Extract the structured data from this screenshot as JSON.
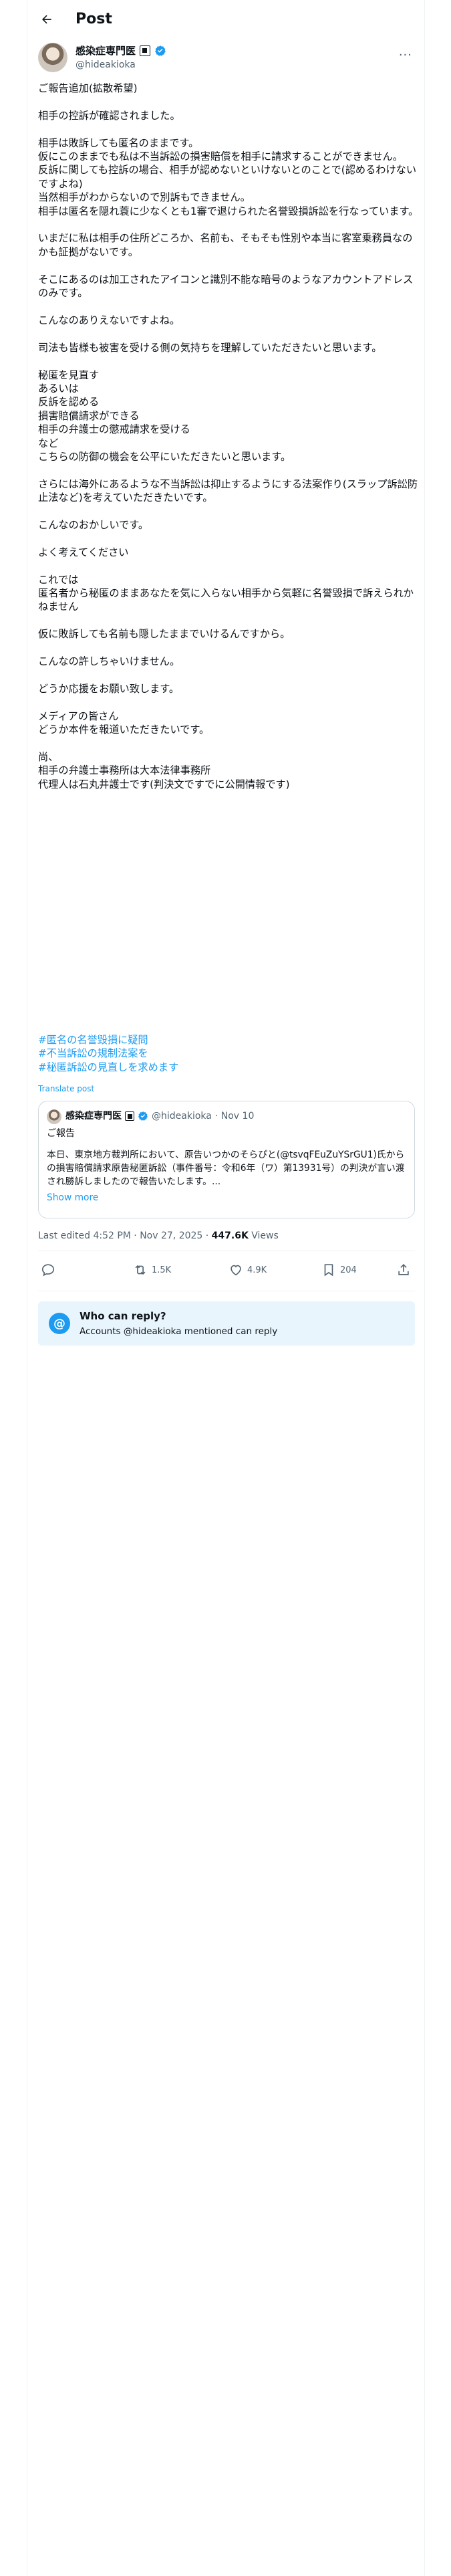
{
  "header": {
    "title": "Post",
    "back_icon": "arrow-left-icon"
  },
  "author": {
    "name": "感染症専門医",
    "badge_icon": "square-tag-icon",
    "verified_icon": "verified-badge-icon",
    "handle": "@hideakioka",
    "more_label": "···"
  },
  "tweet": {
    "text": "ご報告追加(拡散希望)\n\n相手の控訴が確認されました。\n\n相手は敗訴しても匿名のままです。\n仮にこのままでも私は不当訴訟の損害賠償を相手に請求することができません。\n反訴に関しても控訴の場合、相手が認めないといけないとのことで(認めるわけないですよね)\n当然相手がわからないので別訴もできません。\n相手は匿名を隠れ蓑に少なくとも1審で退けられた名誉毀損訴訟を行なっています。\n\nいまだに私は相手の住所どころか、名前も、そもそも性別や本当に客室乗務員なのかも証拠がないです。\n\nそこにあるのは加工されたアイコンと識別不能な暗号のようなアカウントアドレスのみです。\n\nこんなのありえないですよね。\n\n司法も皆様も被害を受ける側の気持ちを理解していただきたいと思います。\n\n秘匿を見直す\nあるいは\n反訴を認める\n損害賠償請求ができる\n相手の弁護士の懲戒請求を受ける\nなど\nこちらの防御の機会を公平にいただきたいと思います。\n\nさらには海外にあるような不当訴訟は抑止するようにする法案作り(スラップ訴訟防止法など)を考えていただきたいです。\n\nこんなのおかしいです。\n\nよく考えてください\n\nこれでは\n匿名者から秘匿のままあなたを気に入らない相手から気軽に名誉毀損で訴えられかねません\n\n仮に敗訴しても名前も隠したままでいけるんですから。\n\nこんなの許しちゃいけません。\n\nどうか応援をお願い致します。\n\nメディアの皆さん\nどうか本件を報道いただきたいです。\n\n尚、\n相手の弁護士事務所は大本法律事務所\n代理人は石丸井護士です(判決文ですでに公開情報です)",
    "hashtags": [
      "#匿名の名誉毀損に疑問",
      "#不当訴訟の規制法案を",
      "#秘匿訴訟の見直しを求めます"
    ],
    "translate_label": "Translate post"
  },
  "quote": {
    "name": "感染症専門医",
    "handle": "@hideakioka",
    "date": "· Nov 10",
    "title": "ご報告",
    "body": "本日、東京地方裁判所において、原告いつかのそらぴと(@tsvqFEuZuYSrGU1)氏からの損害賠償請求原告秘匿訴訟（事件番号：令和6年（ワ）第13931号）の判決が言い渡され勝訴しましたので報告いたします。...",
    "show_more": "Show more"
  },
  "meta": {
    "edited": "Last edited 4:52 PM · Nov 27, 2025 · ",
    "views_count": "447.6K",
    "views_label": " Views"
  },
  "actions": {
    "reply_icon": "reply-icon",
    "retweet_icon": "retweet-icon",
    "retweet_count": "1.5K",
    "like_icon": "heart-icon",
    "like_count": "4.9K",
    "bookmark_icon": "bookmark-icon",
    "bookmark_count": "204",
    "share_icon": "share-icon"
  },
  "reply_restriction": {
    "icon": "at-sign-icon",
    "title": "Who can reply?",
    "subtitle": "Accounts @hideakioka mentioned can reply"
  },
  "colors": {
    "accent": "#1d9bf0",
    "text": "#0f1419",
    "muted": "#536471",
    "border": "#cfd9de"
  }
}
